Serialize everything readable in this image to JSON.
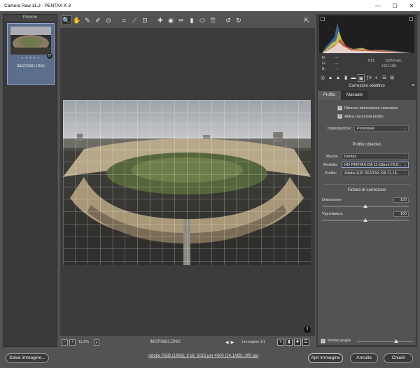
{
  "window": {
    "title": "Camera Raw 11.3  -  PENTAX K-3",
    "minimize": "—",
    "maximize": "☐",
    "close": "✕"
  },
  "filmstrip": {
    "header": "Provino",
    "thumbnail": {
      "stars": "• • • • •",
      "filename": "IMGP0681.DNG"
    }
  },
  "toolbar": {
    "tools": [
      {
        "name": "zoom-tool",
        "glyph": "🔍"
      },
      {
        "name": "hand-tool",
        "glyph": "✋"
      },
      {
        "name": "white-balance-tool",
        "glyph": "✎"
      },
      {
        "name": "color-sampler-tool",
        "glyph": "✐"
      },
      {
        "name": "targeted-adjustment-tool",
        "glyph": "⊙"
      },
      {
        "name": "crop-tool",
        "glyph": "⌗"
      },
      {
        "name": "straighten-tool",
        "glyph": "⟋"
      },
      {
        "name": "transform-tool",
        "glyph": "⊡"
      },
      {
        "name": "spot-removal-tool",
        "glyph": "✚"
      },
      {
        "name": "red-eye-tool",
        "glyph": "◉"
      },
      {
        "name": "adjustment-brush-tool",
        "glyph": "✏"
      },
      {
        "name": "graduated-filter-tool",
        "glyph": "▮"
      },
      {
        "name": "radial-filter-tool",
        "glyph": "⬭"
      },
      {
        "name": "preferences-tool",
        "glyph": "☰"
      },
      {
        "name": "rotate-ccw-tool",
        "glyph": "↺"
      },
      {
        "name": "rotate-cw-tool",
        "glyph": "↻"
      }
    ],
    "fullscreen_glyph": "⇱"
  },
  "statusbar": {
    "zoom": "11,6%",
    "filename": "IMGP0681.DNG",
    "image_counter": "Immagine 1/1",
    "prev": "◀",
    "next": "▶",
    "view_buttons": [
      "Y",
      "▮",
      "✚",
      "☰"
    ]
  },
  "histogram_readout": {
    "r_label": "R:",
    "g_label": "G:",
    "b_label": "B:",
    "r_value": "---",
    "g_value": "---",
    "b_value": "---",
    "aperture": "f/11",
    "shutter": "1/250 sec",
    "iso": "ISO 100"
  },
  "panel": {
    "section_title": "Correzioni obiettivo",
    "tabs": [
      "Profilo",
      "Manuale"
    ],
    "active_tab": 0,
    "checkboxes": [
      {
        "label": "Rimuovi aberrazione cromatica",
        "checked": true
      },
      {
        "label": "Attiva correzioni profilo",
        "checked": true
      }
    ],
    "setting": {
      "label": "Impostazione:",
      "value": "Personale"
    },
    "profile_group_title": "Profilo obiettivo",
    "fields": [
      {
        "label": "Marca:",
        "value": "Pentax"
      },
      {
        "label": "Modello:",
        "value": "HD PENTAX-DA 11-18mm F2.8..."
      },
      {
        "label": "Profilo:",
        "value": "Adobe (HD PENTAX-DA 11-18..."
      }
    ],
    "factor_title": "Fattore di correzione",
    "sliders": [
      {
        "label": "Distorsione",
        "value": "100",
        "level": 0.5
      },
      {
        "label": "Vignettatura",
        "value": "100",
        "level": 0.5
      }
    ]
  },
  "grid_overlay": {
    "label": "Mostra griglia",
    "checked": true,
    "level": 0.7
  },
  "footer": {
    "save_label": "Salva immagine...",
    "workflow_link": "Adobe RGB (1998); 8 bit; 6016 per 4000 (24,1MB); 300 ppi",
    "open_label": "Apri immagine",
    "cancel_label": "Annulla",
    "close_label": "Chiudi"
  },
  "colors": {
    "background": "#535353",
    "panel": "#3b3b3b",
    "accent": "#8fa7cf"
  }
}
